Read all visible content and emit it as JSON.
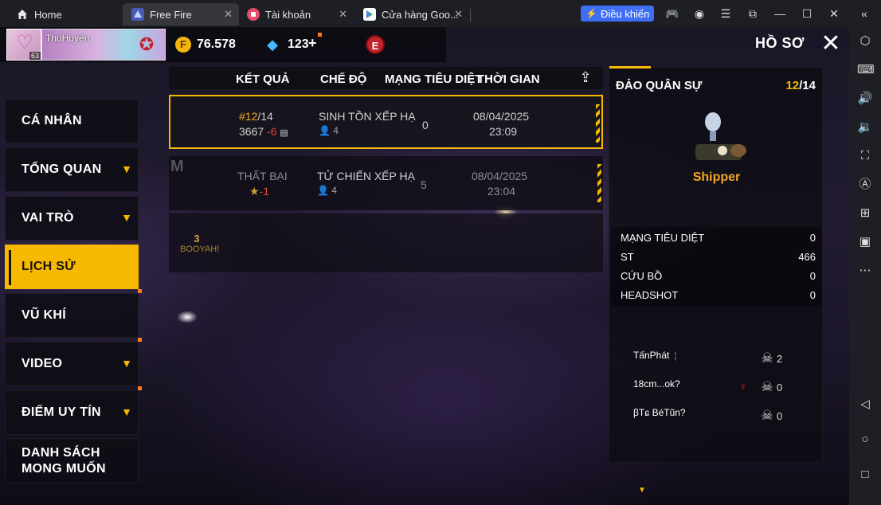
{
  "browser": {
    "tabs": [
      {
        "label": "Home",
        "icon": "home-icon"
      },
      {
        "label": "Free Fire",
        "icon": "free-fire-icon"
      },
      {
        "label": "Tài khoản",
        "icon": "account-icon"
      },
      {
        "label": "Cửa hàng Goo...",
        "icon": "play-store-icon"
      }
    ],
    "control_label": "Điều khiển"
  },
  "profile": {
    "name": "ThuHuyền",
    "level": "63",
    "gold": "76.578",
    "diamonds": "123",
    "diamond_plus": "+",
    "elite_letter": "E"
  },
  "page_title": "HỒ SƠ",
  "nav": [
    {
      "label": "CÁ NHÂN",
      "chevron": false
    },
    {
      "label": "TỔNG QUAN",
      "chevron": true
    },
    {
      "label": "VAI TRÒ",
      "chevron": true
    },
    {
      "label": "LỊCH SỬ",
      "chevron": false,
      "active": true
    },
    {
      "label": "VŨ KHÍ",
      "chevron": false
    },
    {
      "label": "VIDEO",
      "chevron": true
    },
    {
      "label": "ĐIỂM UY TÍN",
      "chevron": true
    },
    {
      "label": "DANH SÁCH\nMONG MUỐN",
      "chevron": false
    }
  ],
  "list": {
    "headers": [
      "KẾT QUẢ",
      "CHẾ ĐỘ",
      "MẠNG TIÊU DIỆT",
      "THỜI GIAN"
    ],
    "rows": [
      {
        "rank": "#12",
        "rank_total": "/14",
        "score": "3667",
        "score_delta": "-6",
        "mode": "SINH TỒN XẾP HẠ",
        "players": "4",
        "kills": "0",
        "date": "08/04/2025",
        "time": "23:09"
      },
      {
        "result": "THẤT BẠI",
        "star_delta": "-1",
        "mode": "TỬ CHIẾN XẾP HẠ",
        "players": "4",
        "kills": "5",
        "date": "08/04/2025",
        "time": "23:04"
      }
    ],
    "booyah_count": "3",
    "booyah_label": "BOOYAH!"
  },
  "detail": {
    "map": "ĐẢO QUÂN SỰ",
    "rank": "12",
    "rank_total": "/14",
    "character": "Shipper",
    "stats": [
      {
        "label": "MẠNG TIÊU DIỆT",
        "value": "0"
      },
      {
        "label": "ST",
        "value": "466"
      },
      {
        "label": "CỨU BỒ",
        "value": "0"
      },
      {
        "label": "HEADSHOT",
        "value": "0"
      }
    ],
    "team": [
      {
        "name": "TấnPhát",
        "sep": "¦",
        "kills": "2"
      },
      {
        "name": "18cm...ok?",
        "sep": "",
        "kills": "0"
      },
      {
        "name": "βTɕ BéTũn?",
        "sep": "",
        "kills": "0"
      }
    ]
  },
  "colors": {
    "accent": "#f6b900",
    "danger": "#e0443c",
    "rank": "#f5a623"
  }
}
